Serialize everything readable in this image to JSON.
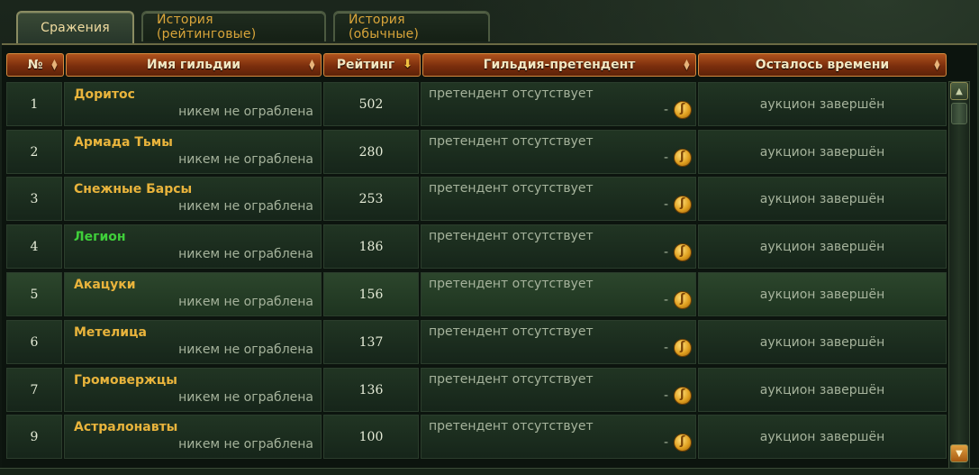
{
  "tabs": [
    {
      "label": "Сражения",
      "active": true
    },
    {
      "label": "История (рейтинговые)",
      "active": false
    },
    {
      "label": "История (обычные)",
      "active": false
    }
  ],
  "columns": {
    "num": "№",
    "name": "Имя гильдии",
    "rating": "Рейтинг",
    "challenger": "Гильдия-претендент",
    "time": "Осталось времени"
  },
  "rows": [
    {
      "num": "1",
      "name": "Доритос",
      "name_color": "gold",
      "robbed": "никем не ограблена",
      "rating": "502",
      "challenger": "претендент отсутствует",
      "dash": "-",
      "time": "аукцион завершён"
    },
    {
      "num": "2",
      "name": "Армада Тьмы",
      "name_color": "gold",
      "robbed": "никем не ограблена",
      "rating": "280",
      "challenger": "претендент отсутствует",
      "dash": "-",
      "time": "аукцион завершён"
    },
    {
      "num": "3",
      "name": "Снежные Барсы",
      "name_color": "gold",
      "robbed": "никем не ограблена",
      "rating": "253",
      "challenger": "претендент отсутствует",
      "dash": "-",
      "time": "аукцион завершён"
    },
    {
      "num": "4",
      "name": "Легион",
      "name_color": "green",
      "robbed": "никем не ограблена",
      "rating": "186",
      "challenger": "претендент отсутствует",
      "dash": "-",
      "time": "аукцион завершён"
    },
    {
      "num": "5",
      "name": "Акацуки",
      "name_color": "gold",
      "robbed": "никем не ограблена",
      "rating": "156",
      "challenger": "претендент отсутствует",
      "dash": "-",
      "time": "аукцион завершён",
      "highlight": true
    },
    {
      "num": "6",
      "name": "Метелица",
      "name_color": "gold",
      "robbed": "никем не ограблена",
      "rating": "137",
      "challenger": "претендент отсутствует",
      "dash": "-",
      "time": "аукцион завершён"
    },
    {
      "num": "7",
      "name": "Громовержцы",
      "name_color": "gold",
      "robbed": "никем не ограблена",
      "rating": "136",
      "challenger": "претендент отсутствует",
      "dash": "-",
      "time": "аукцион завершён"
    },
    {
      "num": "9",
      "name": "Астралонавты",
      "name_color": "gold",
      "robbed": "никем не ограблена",
      "rating": "100",
      "challenger": "претендент отсутствует",
      "dash": "-",
      "time": "аукцион завершён"
    }
  ],
  "icons": {
    "coin": "gold-coin-icon",
    "sort": "sort-arrows-icon",
    "sort_active": "sort-desc-icon"
  },
  "colors": {
    "gold_name": "#e9b43c",
    "green_name": "#3fcf3a",
    "header": "#8a3510",
    "row_bg": "#1c2e1e"
  }
}
